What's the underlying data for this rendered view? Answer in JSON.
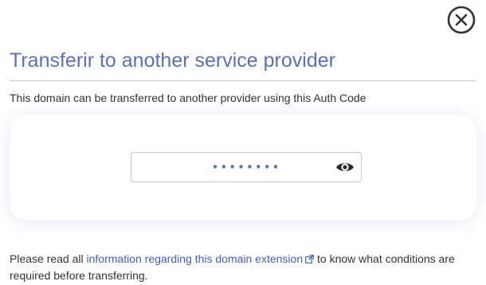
{
  "dialog": {
    "title": "Transferir to another service provider",
    "description": "This domain can be transferred to another provider using this Auth Code",
    "auth_code": {
      "masked_value": "••••••••",
      "toggle_icon": "eye-icon"
    },
    "footer": {
      "text_before": "Please read all ",
      "link_label": "information regarding this domain extension",
      "link_icon": "external-link-icon",
      "text_after": " to know what conditions are required before transferring."
    },
    "close_icon": "close-icon"
  },
  "colors": {
    "accent": "#5b6fc0",
    "link": "#4060c0",
    "text": "#333333"
  }
}
